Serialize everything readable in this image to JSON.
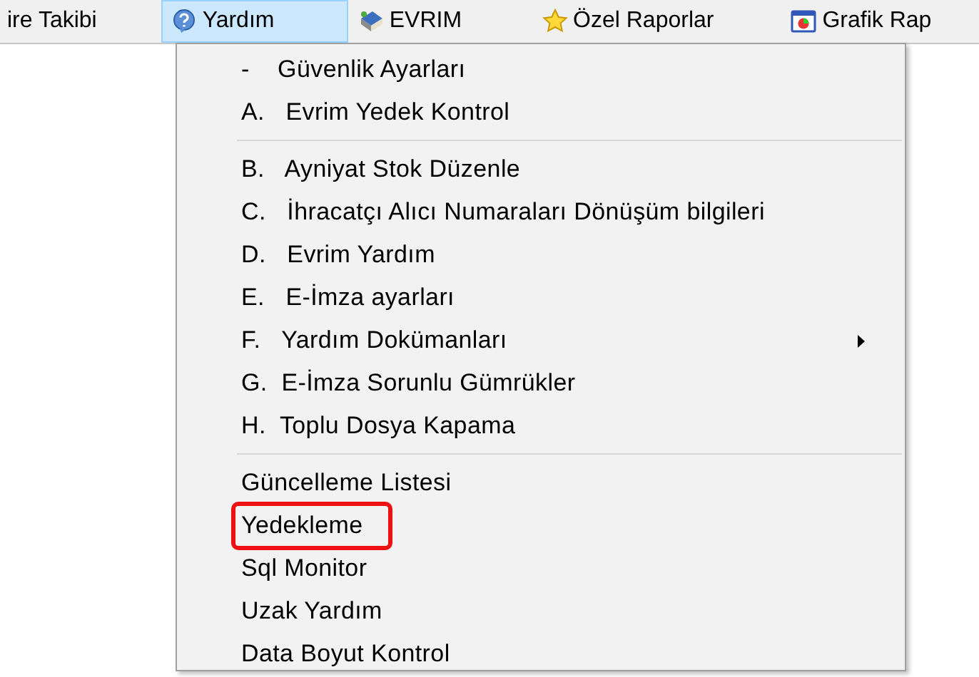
{
  "menubar": [
    {
      "label": "ire Takibi",
      "selected": false
    },
    {
      "label": "Yardım",
      "selected": true
    },
    {
      "label": "EVRIM",
      "selected": false
    },
    {
      "label": "Özel Raporlar",
      "selected": false
    },
    {
      "label": "Grafik Rap",
      "selected": false
    }
  ],
  "dropdown": {
    "groups": [
      [
        {
          "text": "-    Güvenlik Ayarları",
          "submenu": false,
          "highlighted": false
        },
        {
          "text": "A.   Evrim Yedek Kontrol",
          "submenu": false,
          "highlighted": false
        }
      ],
      [
        {
          "text": "B.   Ayniyat Stok Düzenle",
          "submenu": false,
          "highlighted": false
        },
        {
          "text": "C.   İhracatçı Alıcı Numaraları Dönüşüm bilgileri",
          "submenu": false,
          "highlighted": false
        },
        {
          "text": "D.   Evrim Yardım",
          "submenu": false,
          "highlighted": false
        },
        {
          "text": "E.   E-İmza ayarları",
          "submenu": false,
          "highlighted": false
        },
        {
          "text": "F.   Yardım Dokümanları",
          "submenu": true,
          "highlighted": false
        },
        {
          "text": "G.  E-İmza Sorunlu Gümrükler",
          "submenu": false,
          "highlighted": false
        },
        {
          "text": "H.  Toplu Dosya Kapama",
          "submenu": false,
          "highlighted": false
        }
      ],
      [
        {
          "text": "Güncelleme Listesi",
          "submenu": false,
          "highlighted": false
        },
        {
          "text": "Yedekleme",
          "submenu": false,
          "highlighted": true
        },
        {
          "text": "Sql Monitor",
          "submenu": false,
          "highlighted": false
        },
        {
          "text": "Uzak Yardım",
          "submenu": false,
          "highlighted": false
        },
        {
          "text": "Data Boyut Kontrol",
          "submenu": false,
          "highlighted": false
        }
      ]
    ]
  }
}
